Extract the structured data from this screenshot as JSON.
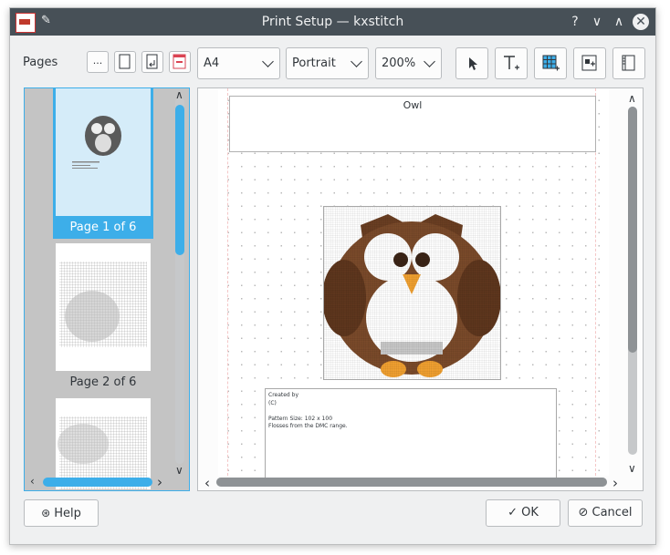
{
  "window": {
    "title": "Print Setup — kxstitch"
  },
  "titlebar": {
    "help_glyph": "?",
    "minimize_glyph": "∨",
    "maximize_glyph": "∧",
    "close_glyph": "✕"
  },
  "toolbar": {
    "pages_label": "Pages",
    "more_label": "...",
    "paper_size": "A4",
    "orientation": "Portrait",
    "zoom": "200%"
  },
  "thumbnails": [
    {
      "caption": "Page 1 of 6",
      "selected": true
    },
    {
      "caption": "Page 2 of 6",
      "selected": false
    },
    {
      "caption": "",
      "selected": false
    }
  ],
  "preview": {
    "header_title": "Owl",
    "info_lines": [
      "Created by",
      "(C)",
      "",
      "Pattern Size: 102 x 100",
      "Flosses from the DMC range."
    ]
  },
  "footer": {
    "help_label": "Help",
    "ok_label": "OK",
    "cancel_label": "Cancel"
  },
  "colors": {
    "accent": "#3daee9",
    "titlebar": "#475057",
    "owl_brown": "#7a4a2a",
    "owl_beak": "#f0a030"
  }
}
